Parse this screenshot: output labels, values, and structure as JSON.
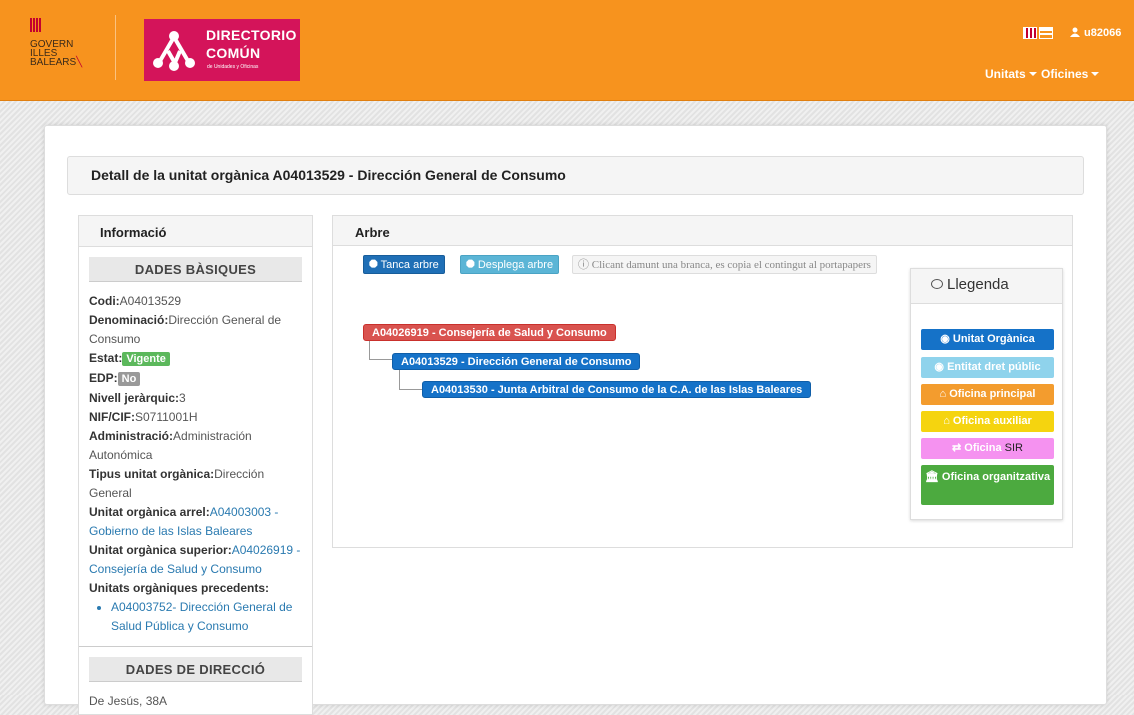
{
  "header": {
    "govern_logo_lines": [
      "GOVERN",
      "ILLES",
      "BALEARS"
    ],
    "directorio_logo": {
      "line1": "DIRECTORIO",
      "line2": "COMÚN",
      "line3": "de Unidades y Oficinas"
    },
    "user": "u82066",
    "nav": [
      {
        "label": "Unitats"
      },
      {
        "label": "Oficines"
      }
    ]
  },
  "page": {
    "title": "Detall de la unitat orgànica A04013529 - Dirección General de Consumo"
  },
  "info": {
    "title": "Informació",
    "basic_section": "DADES BÀSIQUES",
    "fields": {
      "codi_label": "Codi:",
      "codi": "A04013529",
      "denominacio_label": "Denominació:",
      "denominacio": "Dirección General de Consumo",
      "estat_label": "Estat:",
      "estat": "Vigente",
      "edp_label": "EDP:",
      "edp": "No",
      "nivell_label": "Nivell jeràrquic:",
      "nivell": "3",
      "nif_label": "NIF/CIF:",
      "nif": "S0711001H",
      "administracio_label": "Administració:",
      "administracio": "Administración Autonómica",
      "tipus_label": "Tipus unitat orgànica:",
      "tipus": "Dirección General",
      "arrel_label": "Unitat orgànica arrel:",
      "arrel": "A04003003 - Gobierno de las Islas Baleares",
      "superior_label": "Unitat orgànica superior:",
      "superior": "A04026919 - Consejería de Salud y Consumo",
      "precedents_label": "Unitats orgàniques precedents:",
      "precedents": [
        "A04003752- Dirección General de Salud Pública y Consumo"
      ]
    },
    "address_section": "DADES DE DIRECCIÓ",
    "address_line": "De Jesús, 38A"
  },
  "arbre": {
    "title": "Arbre",
    "collapse_button": "Tanca arbre",
    "expand_button": "Desplega arbre",
    "note": "Clicant damunt una branca, es copia el contingut al portapapers",
    "nodes": [
      {
        "label": "A04026919 - Consejería de Salud y Consumo"
      },
      {
        "label": "A04013529 - Dirección General de Consumo"
      },
      {
        "label": "A04013530 - Junta Arbitral de Consumo de la C.A. de las Islas Baleares"
      }
    ]
  },
  "legend": {
    "title": "Llegenda",
    "items": [
      {
        "label": "Unitat Orgànica",
        "color": "#1572c8"
      },
      {
        "label": "Entitat dret públic",
        "color": "#8fd3ec"
      },
      {
        "label": "Oficina principal",
        "color": "#f39c2e"
      },
      {
        "label": "Oficina auxiliar",
        "color": "#f5d40f"
      },
      {
        "label": "Oficina",
        "suffix": "SIR",
        "color": "#f592f0"
      },
      {
        "label": "Oficina organitzativa",
        "color": "#4caa3f"
      }
    ]
  }
}
